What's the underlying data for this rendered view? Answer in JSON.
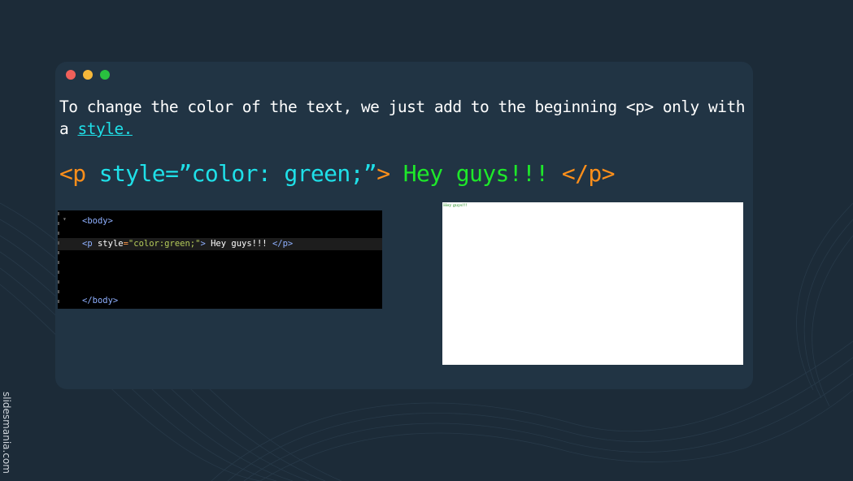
{
  "window": {
    "controls": [
      {
        "name": "close",
        "color": "#f0605a"
      },
      {
        "name": "minimize",
        "color": "#f6b83a"
      },
      {
        "name": "maximize",
        "color": "#29c13f"
      }
    ]
  },
  "intro": {
    "text": "To change the color of the text, we just add to the beginning <p> only with a ",
    "link_text": "style."
  },
  "code_example": {
    "open_tag": "<p ",
    "attr_name": "style=",
    "attr_value": "”color: green;”",
    "close_bracket": ">",
    "content": " Hey guys!!! ",
    "end_tag": "</p>"
  },
  "editor": {
    "line_body_open": "<body>",
    "p_open": "<p",
    "p_attr": " style",
    "p_eq": "=",
    "p_value": "\"color:green;\"",
    "p_gt": ">",
    "p_text": " Hey guys!!! ",
    "p_close": "</p>",
    "line_body_close": "</body>"
  },
  "preview": {
    "text": "Hey guys!!!"
  },
  "credit": "slidesmania.com",
  "colors": {
    "background": "#1c2b38",
    "card": "#213444",
    "accent_orange": "#ff8f1a",
    "accent_cyan": "#1fe0e8",
    "accent_green": "#1ee82a"
  }
}
